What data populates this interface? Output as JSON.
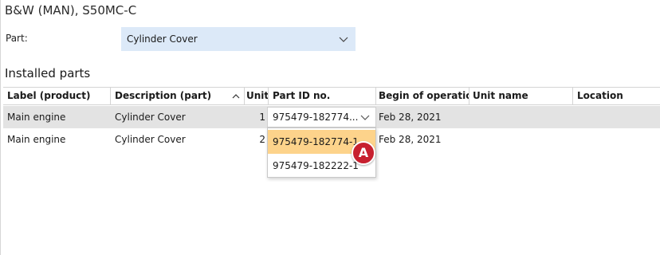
{
  "window": {
    "title": "B&W (MAN), S50MC-C"
  },
  "part_selector": {
    "label": "Part:",
    "value": "Cylinder Cover",
    "icon": "chevron-down-icon"
  },
  "installed": {
    "title": "Installed parts",
    "columns": [
      "Label (product)",
      "Description (part)",
      "Unit",
      "Part ID no.",
      "Begin of operation",
      "Unit name",
      "Location"
    ],
    "sorted_column": "Description (part)",
    "sort_direction": "ascending",
    "rows": [
      {
        "label": "Main engine",
        "description": "Cylinder Cover",
        "unit": "1",
        "part_id": "975479-182774...",
        "begin": "Feb 28, 2021",
        "unit_name": "",
        "location": "",
        "selected": true
      },
      {
        "label": "Main engine",
        "description": "Cylinder Cover",
        "unit": "2",
        "part_id": "",
        "begin": "Feb 28, 2021",
        "unit_name": "",
        "location": "",
        "selected": false
      }
    ]
  },
  "part_id_dropdown": {
    "options": [
      "975479-182774-1",
      "975479-182222-1"
    ],
    "highlighted": "975479-182774-1"
  },
  "callout": {
    "label": "A",
    "color": "#c7202f"
  },
  "colors": {
    "select_bg": "#dce9f8",
    "selected_row": "#e3e3e3",
    "highlight": "#fdd38b"
  }
}
